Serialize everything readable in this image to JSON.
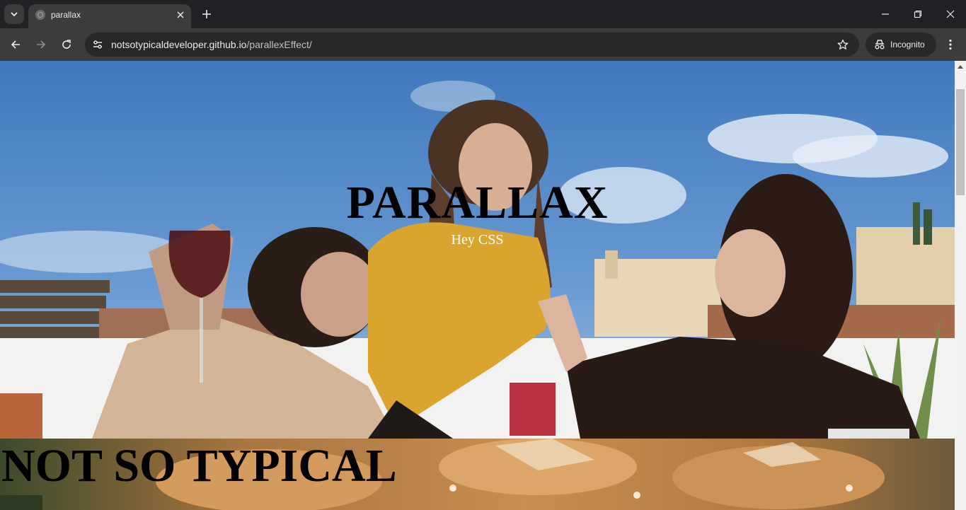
{
  "browser": {
    "tab": {
      "title": "parallax",
      "favicon": "globe-icon"
    },
    "url": {
      "host": "notsotypicaldeveloper.github.io",
      "path": "/parallexEffect/"
    },
    "incognito_label": "Incognito",
    "icons": {
      "tab_search": "chevron-down-icon",
      "tab_close": "close-icon",
      "new_tab": "plus-icon",
      "minimize": "minimize-icon",
      "restore": "restore-icon",
      "close_window": "close-icon",
      "back": "arrow-left-icon",
      "forward": "arrow-right-icon",
      "reload": "reload-icon",
      "site_info": "tune-icon",
      "bookmark": "star-icon",
      "incognito": "incognito-icon",
      "menu": "kebab-menu-icon"
    }
  },
  "page": {
    "hero": {
      "title": "PARALLAX",
      "subtitle": "Hey CSS"
    },
    "section2": {
      "title": "NOT SO TYPICAL"
    }
  },
  "colors": {
    "chrome_dark": "#202124",
    "toolbar": "#3c3c3c",
    "omnibox": "#282828",
    "sky": "#4f86c6",
    "hero_title": "#000000",
    "hero_subtitle": "#ffffff"
  }
}
